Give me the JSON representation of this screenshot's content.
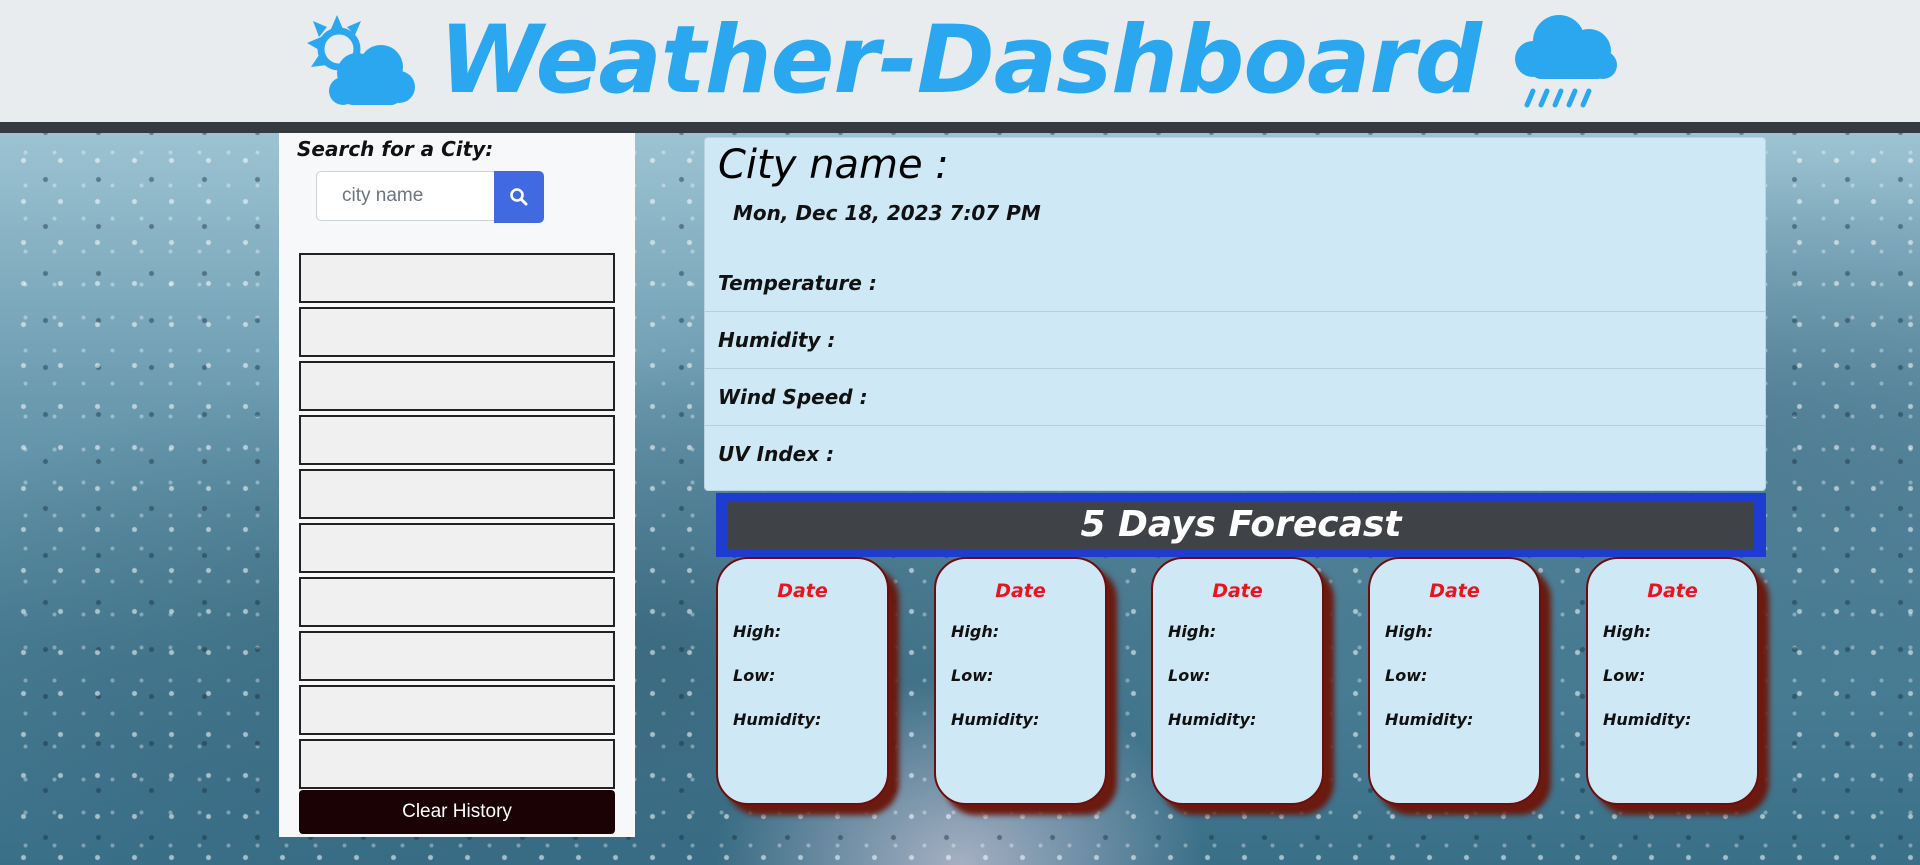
{
  "header": {
    "title": "Weather-Dashboard",
    "left_icon": "sun-cloud-icon",
    "right_icon": "rain-cloud-icon",
    "title_color": "#2aa7ee"
  },
  "sidebar": {
    "search_label": "Search for a City:",
    "search_placeholder": "city name",
    "search_value": "",
    "search_icon": "search-icon",
    "history_items": [
      "",
      "",
      "",
      "",
      "",
      "",
      "",
      "",
      "",
      ""
    ],
    "clear_button_label": "Clear History"
  },
  "current": {
    "city_label": "City name :",
    "date_time": "Mon, Dec 18, 2023 7:07 PM",
    "temperature_label": "Temperature :",
    "humidity_label": "Humidity :",
    "wind_label": "Wind Speed :",
    "uv_label": "UV Index :"
  },
  "forecast": {
    "title": "5 Days Forecast",
    "cards": [
      {
        "date": "Date",
        "high": "High:",
        "low": "Low:",
        "humidity": "Humidity:"
      },
      {
        "date": "Date",
        "high": "High:",
        "low": "Low:",
        "humidity": "Humidity:"
      },
      {
        "date": "Date",
        "high": "High:",
        "low": "Low:",
        "humidity": "Humidity:"
      },
      {
        "date": "Date",
        "high": "High:",
        "low": "Low:",
        "humidity": "Humidity:"
      },
      {
        "date": "Date",
        "high": "High:",
        "low": "Low:",
        "humidity": "Humidity:"
      }
    ]
  },
  "colors": {
    "accent_blue": "#4169e1",
    "forecast_border": "#1e3ccf",
    "card_date_red": "#e8141e",
    "card_shadow": "#6a1a0e"
  }
}
